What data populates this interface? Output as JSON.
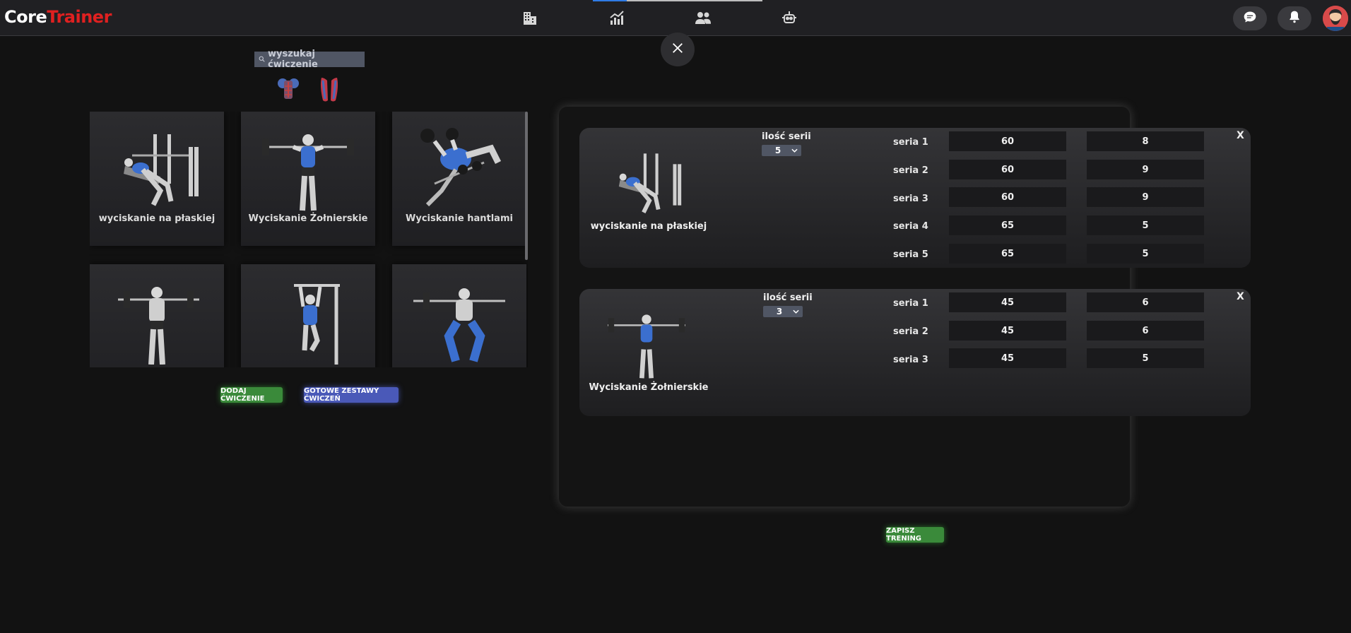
{
  "app": {
    "logo_part1": "Core",
    "logo_part2": "Trainer"
  },
  "nav": {
    "icons": [
      "building-icon",
      "chart-icon",
      "users-icon",
      "robot-icon"
    ]
  },
  "header_actions": [
    "chat-icon",
    "bell-icon",
    "avatar"
  ],
  "search": {
    "placeholder": "wyszukaj ćwiczenie"
  },
  "exercises": [
    {
      "label": "wyciskanie na płaskiej"
    },
    {
      "label": "Wyciskanie Żołnierskie"
    },
    {
      "label": "Wyciskanie hantlami"
    },
    {
      "label": ""
    },
    {
      "label": ""
    },
    {
      "label": ""
    }
  ],
  "buttons": {
    "add_exercise": "dodaj ćwiczenie",
    "ready_sets": "gotowe zestawy ćwiczeń",
    "save_training": "zapisz trening"
  },
  "workout": [
    {
      "name": "wyciskanie na płaskiej",
      "sets_label": "ilość serii",
      "sets_count": "5",
      "sets": [
        {
          "label": "seria 1",
          "weight": "60",
          "reps": "8"
        },
        {
          "label": "seria 2",
          "weight": "60",
          "reps": "9"
        },
        {
          "label": "seria 3",
          "weight": "60",
          "reps": "9"
        },
        {
          "label": "seria 4",
          "weight": "65",
          "reps": "5"
        },
        {
          "label": "seria 5",
          "weight": "65",
          "reps": "5"
        }
      ],
      "remove": "X"
    },
    {
      "name": "Wyciskanie Żołnierskie",
      "sets_label": "ilość serii",
      "sets_count": "3",
      "sets": [
        {
          "label": "seria 1",
          "weight": "45",
          "reps": "6"
        },
        {
          "label": "seria 2",
          "weight": "45",
          "reps": "6"
        },
        {
          "label": "seria 3",
          "weight": "45",
          "reps": "5"
        }
      ],
      "remove": "X"
    }
  ],
  "colors": {
    "brand_red": "#e02020",
    "green": "#3a8a3a",
    "blue": "#4a59b8",
    "accent_blue": "#2f7be6"
  }
}
